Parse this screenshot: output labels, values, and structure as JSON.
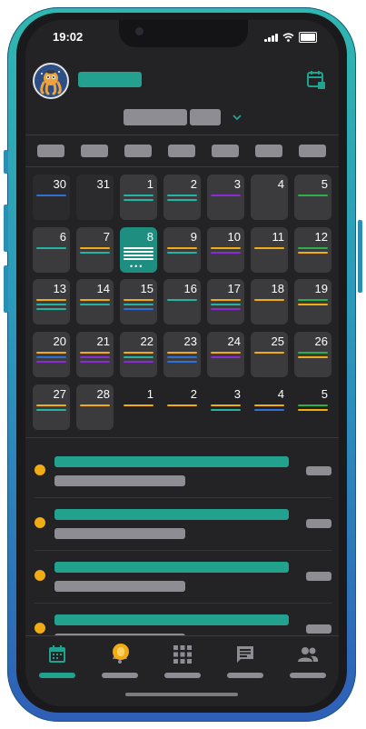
{
  "status_bar": {
    "time": "19:02"
  },
  "calendar": {
    "weeks": [
      [
        {
          "day": "30",
          "style": "dim",
          "lines": [
            "#2f6fd6"
          ]
        },
        {
          "day": "31",
          "style": "dim",
          "lines": []
        },
        {
          "day": "1",
          "style": "normal",
          "lines": [
            "#25b3a4",
            "#25b3a4"
          ]
        },
        {
          "day": "2",
          "style": "normal",
          "lines": [
            "#25b3a4",
            "#25b3a4"
          ]
        },
        {
          "day": "3",
          "style": "normal",
          "lines": [
            "#8b2bd3"
          ]
        },
        {
          "day": "4",
          "style": "normal",
          "lines": []
        },
        {
          "day": "5",
          "style": "normal",
          "lines": [
            "#2db04b"
          ]
        }
      ],
      [
        {
          "day": "6",
          "style": "normal",
          "lines": [
            "#25b3a4"
          ]
        },
        {
          "day": "7",
          "style": "normal",
          "lines": [
            "#f0ab15",
            "#25b3a4"
          ]
        },
        {
          "day": "8",
          "style": "today",
          "lines": []
        },
        {
          "day": "9",
          "style": "normal",
          "lines": [
            "#f0ab15",
            "#25b3a4"
          ]
        },
        {
          "day": "10",
          "style": "normal",
          "lines": [
            "#f0ab15",
            "#8b2bd3"
          ]
        },
        {
          "day": "11",
          "style": "normal",
          "lines": [
            "#f0ab15"
          ]
        },
        {
          "day": "12",
          "style": "normal",
          "lines": [
            "#2db04b",
            "#f0ab15"
          ]
        }
      ],
      [
        {
          "day": "13",
          "style": "normal",
          "lines": [
            "#f0ab15",
            "#25b3a4",
            "#25b3a4"
          ]
        },
        {
          "day": "14",
          "style": "normal",
          "lines": [
            "#f0ab15",
            "#25b3a4"
          ]
        },
        {
          "day": "15",
          "style": "normal",
          "lines": [
            "#f0ab15",
            "#25b3a4",
            "#2f6fd6"
          ]
        },
        {
          "day": "16",
          "style": "normal",
          "lines": [
            "#25b3a4"
          ]
        },
        {
          "day": "17",
          "style": "normal",
          "lines": [
            "#f0ab15",
            "#25b3a4",
            "#8b2bd3"
          ]
        },
        {
          "day": "18",
          "style": "normal",
          "lines": [
            "#f0ab15"
          ]
        },
        {
          "day": "19",
          "style": "normal",
          "lines": [
            "#2db04b",
            "#f0ab15"
          ]
        }
      ],
      [
        {
          "day": "20",
          "style": "normal",
          "lines": [
            "#f0ab15",
            "#2f6fd6",
            "#8b2bd3"
          ]
        },
        {
          "day": "21",
          "style": "normal",
          "lines": [
            "#f0ab15",
            "#8b2bd3",
            "#8b2bd3"
          ]
        },
        {
          "day": "22",
          "style": "normal",
          "lines": [
            "#f0ab15",
            "#25b3a4",
            "#8b2bd3"
          ]
        },
        {
          "day": "23",
          "style": "normal",
          "lines": [
            "#f0ab15",
            "#2f6fd6",
            "#2f6fd6"
          ]
        },
        {
          "day": "24",
          "style": "normal",
          "lines": [
            "#f0ab15",
            "#8b2bd3"
          ]
        },
        {
          "day": "25",
          "style": "normal",
          "lines": [
            "#f0ab15"
          ]
        },
        {
          "day": "26",
          "style": "normal",
          "lines": [
            "#2db04b",
            "#f0ab15"
          ]
        }
      ],
      [
        {
          "day": "27",
          "style": "normal",
          "lines": [
            "#f0ab15",
            "#25b3a4"
          ]
        },
        {
          "day": "28",
          "style": "normal",
          "lines": [
            "#f0ab15"
          ]
        },
        {
          "day": "1",
          "style": "none",
          "lines": [
            "#f0ab15"
          ]
        },
        {
          "day": "2",
          "style": "none",
          "lines": [
            "#f0ab15"
          ]
        },
        {
          "day": "3",
          "style": "none",
          "lines": [
            "#f0ab15",
            "#25b3a4"
          ]
        },
        {
          "day": "4",
          "style": "none",
          "lines": [
            "#f0ab15",
            "#2f6fd6"
          ]
        },
        {
          "day": "5",
          "style": "none",
          "lines": [
            "#2db04b",
            "#f0ab15"
          ]
        }
      ]
    ]
  },
  "events_count": 4,
  "tabs": [
    "calendar-icon",
    "bell-icon",
    "grid-icon",
    "chat-icon",
    "people-icon"
  ],
  "colors": {
    "accent": "#22a18f",
    "warning": "#f0ab15",
    "background": "#232325"
  }
}
